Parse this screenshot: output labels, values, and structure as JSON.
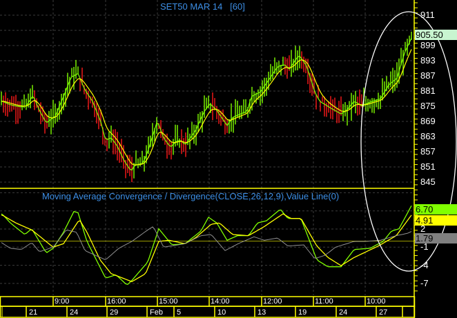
{
  "chart_data": [
    {
      "type": "line",
      "title": "SET50 MAR 14",
      "interval": "[60]",
      "ylim": [
        842,
        913
      ],
      "y_ticks": [
        "911",
        "905",
        "899",
        "893",
        "887",
        "881",
        "875",
        "869",
        "863",
        "857",
        "851",
        "845"
      ],
      "last_price_label": "905.50",
      "last_price": 905.5,
      "series_note_colors": {
        "up": "#80ff00",
        "down": "#ff1a1a",
        "fast_ma": "#80ff00",
        "slow_ma": "#ffff00"
      },
      "fast_ma": [
        [
          3,
          877.0
        ],
        [
          15,
          875.6
        ],
        [
          31,
          874.7
        ],
        [
          38,
          875.2
        ],
        [
          48,
          879.3
        ],
        [
          57,
          873.4
        ],
        [
          67,
          868.4
        ],
        [
          80,
          871.1
        ],
        [
          92,
          878.8
        ],
        [
          103,
          886.5
        ],
        [
          113,
          887.9
        ],
        [
          123,
          881.5
        ],
        [
          134,
          877.0
        ],
        [
          146,
          868.8
        ],
        [
          153,
          861.6
        ],
        [
          161,
          862.5
        ],
        [
          169,
          859.7
        ],
        [
          180,
          853.4
        ],
        [
          190,
          849.3
        ],
        [
          195,
          851.6
        ],
        [
          207,
          852.5
        ],
        [
          214,
          857.0
        ],
        [
          228,
          869.3
        ],
        [
          237,
          862.5
        ],
        [
          247,
          858.8
        ],
        [
          255,
          861.1
        ],
        [
          262,
          861.6
        ],
        [
          268,
          859.7
        ],
        [
          283,
          865.2
        ],
        [
          295,
          872.5
        ],
        [
          304,
          876.1
        ],
        [
          314,
          873.4
        ],
        [
          329,
          867.4
        ],
        [
          337,
          870.6
        ],
        [
          349,
          872.0
        ],
        [
          358,
          872.9
        ],
        [
          364,
          878.8
        ],
        [
          377,
          880.6
        ],
        [
          391,
          886.1
        ],
        [
          402,
          890.6
        ],
        [
          412,
          891.5
        ],
        [
          419,
          889.7
        ],
        [
          433,
          895.2
        ],
        [
          444,
          891.1
        ],
        [
          456,
          880.6
        ],
        [
          463,
          877.0
        ],
        [
          479,
          874.3
        ],
        [
          494,
          872.0
        ],
        [
          502,
          873.4
        ],
        [
          513,
          877.0
        ],
        [
          524,
          875.2
        ],
        [
          536,
          876.6
        ],
        [
          551,
          877.9
        ],
        [
          563,
          883.4
        ],
        [
          575,
          886.1
        ],
        [
          586,
          896.1
        ],
        [
          597,
          902.5
        ]
      ]
    },
    {
      "type": "line",
      "title": "Moving Average Convergence / Divergence(CLOSE,26,12,9),Value Line(0)",
      "ylim": [
        -8.5,
        8.5
      ],
      "y_ticks": [
        "2",
        "-1",
        "-4",
        "-7"
      ],
      "value_labels": {
        "macd": "6.70",
        "signal": "4.91",
        "diff": "1.79"
      },
      "colors": {
        "macd": "#80ff00",
        "signal": "#ffff00",
        "diff": "#909090",
        "zero": "#9a9a00"
      },
      "series": [
        {
          "name": "macd",
          "points": [
            [
              3,
              4.51
            ],
            [
              15,
              3.0
            ],
            [
              36,
              1.09
            ],
            [
              46,
              2.04
            ],
            [
              67,
              -1.95
            ],
            [
              77,
              -1.19
            ],
            [
              92,
              1.47
            ],
            [
              107,
              4.89
            ],
            [
              113,
              4.7
            ],
            [
              126,
              -0.05
            ],
            [
              153,
              -6.13
            ],
            [
              168,
              -5.56
            ],
            [
              184,
              -7.27
            ],
            [
              191,
              -6.5
            ],
            [
              214,
              -3.47
            ],
            [
              230,
              2.04
            ],
            [
              249,
              -0.62
            ],
            [
              268,
              -0.43
            ],
            [
              291,
              1.66
            ],
            [
              302,
              3.94
            ],
            [
              314,
              3.0
            ],
            [
              329,
              0.14
            ],
            [
              344,
              0.9
            ],
            [
              360,
              0.9
            ],
            [
              373,
              3.0
            ],
            [
              386,
              3.37
            ],
            [
              406,
              5.27
            ],
            [
              417,
              3.75
            ],
            [
              436,
              3.75
            ],
            [
              459,
              -3.1
            ],
            [
              475,
              -4.24
            ],
            [
              494,
              -4.24
            ],
            [
              513,
              -1.38
            ],
            [
              536,
              -1.19
            ],
            [
              555,
              -0.05
            ],
            [
              567,
              1.66
            ],
            [
              578,
              2.04
            ],
            [
              600,
              6.7
            ]
          ]
        },
        {
          "name": "signal",
          "points": [
            [
              3,
              4.32
            ],
            [
              23,
              3.0
            ],
            [
              46,
              1.85
            ],
            [
              77,
              -1.0
            ],
            [
              92,
              -0.43
            ],
            [
              115,
              3.56
            ],
            [
              126,
              1.47
            ],
            [
              145,
              -3.1
            ],
            [
              161,
              -5.37
            ],
            [
              191,
              -6.7
            ],
            [
              211,
              -5.37
            ],
            [
              230,
              -0.05
            ],
            [
              245,
              0.14
            ],
            [
              268,
              -0.43
            ],
            [
              283,
              0.52
            ],
            [
              306,
              2.8
            ],
            [
              318,
              3.0
            ],
            [
              337,
              1.09
            ],
            [
              360,
              0.9
            ],
            [
              383,
              2.42
            ],
            [
              410,
              4.51
            ],
            [
              421,
              3.75
            ],
            [
              436,
              3.75
            ],
            [
              459,
              -0.81
            ],
            [
              475,
              -2.7
            ],
            [
              494,
              -4.05
            ],
            [
              513,
              -2.7
            ],
            [
              548,
              -0.81
            ],
            [
              574,
              0.9
            ],
            [
              600,
              4.91
            ]
          ]
        },
        {
          "name": "diff",
          "points": [
            [
              2,
              -0.24
            ],
            [
              15,
              -1.19
            ],
            [
              31,
              -1.38
            ],
            [
              46,
              -0.24
            ],
            [
              57,
              -1.76
            ],
            [
              77,
              -1.0
            ],
            [
              96,
              1.85
            ],
            [
              111,
              1.47
            ],
            [
              123,
              -1.57
            ],
            [
              153,
              -3.1
            ],
            [
              172,
              -1.19
            ],
            [
              191,
              -0.05
            ],
            [
              214,
              1.85
            ],
            [
              222,
              2.42
            ],
            [
              237,
              -1.0
            ],
            [
              268,
              -0.43
            ],
            [
              291,
              0.9
            ],
            [
              306,
              1.09
            ],
            [
              326,
              -1.57
            ],
            [
              345,
              -0.43
            ],
            [
              368,
              0.71
            ],
            [
              383,
              0.14
            ],
            [
              402,
              0.52
            ],
            [
              417,
              -0.81
            ],
            [
              440,
              -0.62
            ],
            [
              456,
              -2.9
            ],
            [
              471,
              -2.33
            ],
            [
              486,
              -1.0
            ],
            [
              513,
              -0.05
            ],
            [
              529,
              -0.05
            ],
            [
              551,
              0.14
            ],
            [
              574,
              0.9
            ],
            [
              590,
              1.28
            ],
            [
              600,
              1.79
            ]
          ]
        }
      ]
    }
  ],
  "time_axis": {
    "hours": [
      "9:00",
      "16:00",
      "15:00",
      "14:00",
      "12:00",
      "11:00",
      "10:00"
    ],
    "dates": [
      "21",
      "24",
      "29",
      "Feb",
      "5",
      "10",
      "13",
      "19",
      "24",
      "27"
    ]
  }
}
